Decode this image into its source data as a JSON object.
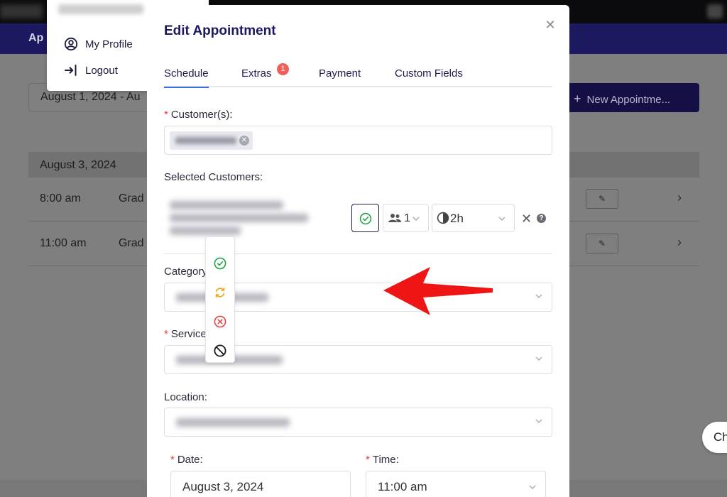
{
  "background": {
    "app_title": "Ap",
    "date_range": "August 1, 2024 - Au",
    "new_appointment_label": "New Appointme...",
    "day_header": "August 3, 2024",
    "rows": [
      {
        "time": "8:00 am",
        "service": "Grad"
      },
      {
        "time": "11:00 am",
        "service": "Grad"
      }
    ]
  },
  "profile_menu": {
    "items": [
      {
        "label": "My Profile",
        "icon": "user-circle-icon"
      },
      {
        "label": "Logout",
        "icon": "logout-icon"
      }
    ]
  },
  "modal": {
    "title": "Edit Appointment",
    "close_icon": "close-icon",
    "tabs": [
      {
        "label": "Schedule",
        "active": true
      },
      {
        "label": "Extras",
        "badge": "1"
      },
      {
        "label": "Payment"
      },
      {
        "label": "Custom Fields"
      }
    ],
    "customers_label": "Customer(s):",
    "selected_customers_label": "Selected Customers:",
    "persons_count": "1",
    "duration": "2h",
    "category_label": "Category:",
    "service_label": "Service:",
    "location_label": "Location:",
    "date_label": "Date:",
    "date_value": "August 3, 2024",
    "time_label": "Time:",
    "time_value": "11:00 am",
    "status_options": [
      {
        "icon": "check-circle-icon",
        "color": "#22a447"
      },
      {
        "icon": "refresh-icon",
        "color": "#e6a817"
      },
      {
        "icon": "x-circle-icon",
        "color": "#e04848"
      },
      {
        "icon": "ban-icon",
        "color": "#1a1a1a"
      }
    ]
  },
  "chat_button": {
    "label": "Ch"
  },
  "colors": {
    "primary": "#1c1960",
    "accent": "#3b6ed8",
    "badge": "#f0605a",
    "annotation_arrow": "#f01515"
  }
}
